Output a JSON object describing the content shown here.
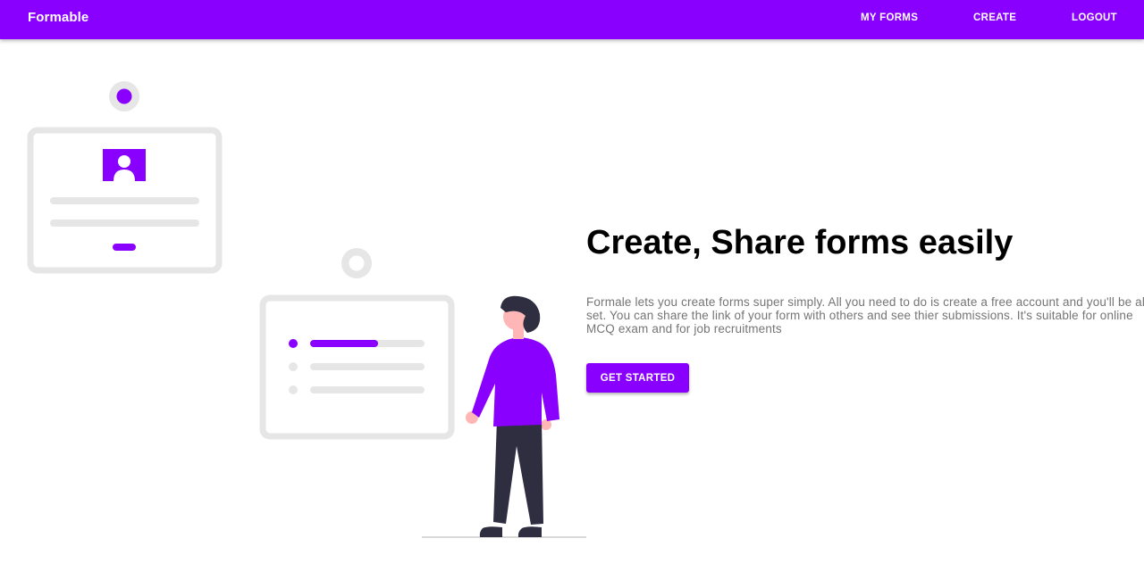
{
  "navbar": {
    "brand": "Formable",
    "links": [
      "MY FORMS",
      "CREATE",
      "LOGOUT"
    ],
    "background": "#8a00ff"
  },
  "hero": {
    "title": "Create, Share forms easily",
    "description": "Formale lets you create forms super simply. All you need to do is create a free account and you'll be all set. You can share the link of your form with others and see thier submissions. It's suitable for online MCQ exam and for job recruitments",
    "cta_label": "GET STARTED"
  },
  "illustration": {
    "accent": "#8a00ff",
    "card_gray": "#e6e6e6",
    "pants": "#2f2e41",
    "skin": "#ffb6b6"
  }
}
